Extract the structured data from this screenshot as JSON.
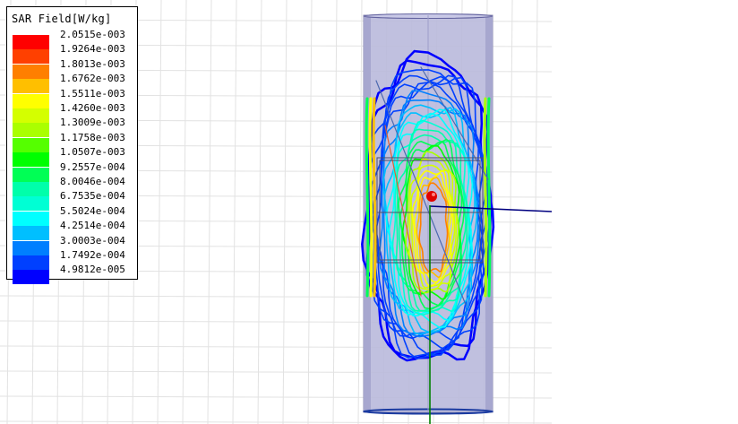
{
  "legend": {
    "title": "SAR Field[W/kg]",
    "entries": [
      {
        "label": "2.0515e-003",
        "color": "#ff0000"
      },
      {
        "label": "1.9264e-003",
        "color": "#ff4000"
      },
      {
        "label": "1.8013e-003",
        "color": "#ff7f00"
      },
      {
        "label": "1.6762e-003",
        "color": "#ffbf00"
      },
      {
        "label": "1.5511e-003",
        "color": "#ffff00"
      },
      {
        "label": "1.4260e-003",
        "color": "#d4ff00"
      },
      {
        "label": "1.3009e-003",
        "color": "#aaff00"
      },
      {
        "label": "1.1758e-003",
        "color": "#55ff00"
      },
      {
        "label": "1.0507e-003",
        "color": "#00ff00"
      },
      {
        "label": "9.2557e-004",
        "color": "#00ff55"
      },
      {
        "label": "8.0046e-004",
        "color": "#00ffaa"
      },
      {
        "label": "6.7535e-004",
        "color": "#00ffd4"
      },
      {
        "label": "5.5024e-004",
        "color": "#00ffff"
      },
      {
        "label": "4.2514e-004",
        "color": "#00bfff"
      },
      {
        "label": "3.0003e-004",
        "color": "#007fff"
      },
      {
        "label": "1.7492e-004",
        "color": "#0040ff"
      },
      {
        "label": "4.9812e-005",
        "color": "#0000ff"
      }
    ]
  },
  "colors": {
    "grid": "#e2e2e2",
    "cylinder_fill": "#b9b9dc",
    "cylinder_edge": "#8a8ab0",
    "axis_x": "#000080",
    "axis_y": "#008000",
    "axis_origin": "#ff0000"
  }
}
